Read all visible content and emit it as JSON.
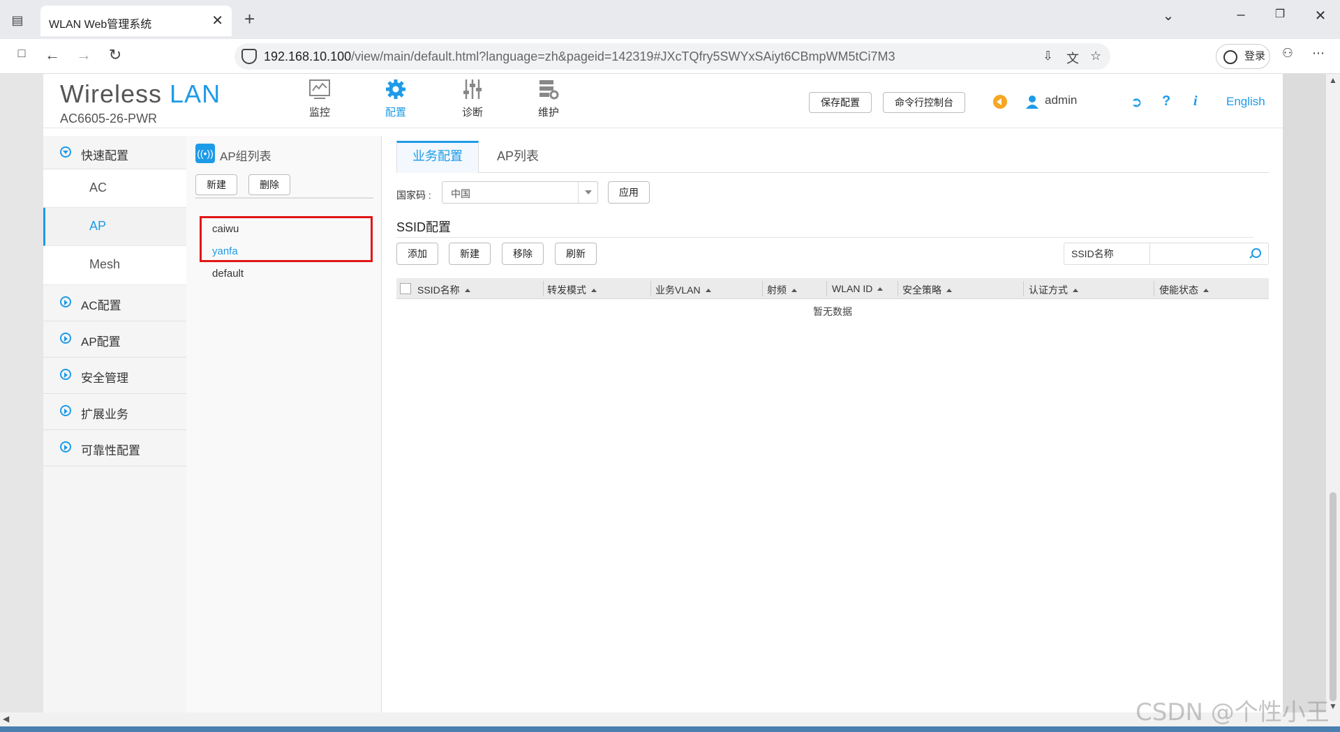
{
  "browser": {
    "tab_title": "WLAN Web管理系统",
    "url_host": "192.168.10.100",
    "url_path": "/view/main/default.html?language=zh&pageid=142319#JXcTQfry5SWYxSAiyt6CBmpWM5tCi7M3",
    "login_label": "登录"
  },
  "header": {
    "brand_wireless": "Wireless",
    "brand_lan": "LAN",
    "model": "AC6605-26-PWR",
    "nav": [
      {
        "label": "监控",
        "icon": "monitor-icon"
      },
      {
        "label": "配置",
        "icon": "gear-icon"
      },
      {
        "label": "诊断",
        "icon": "diagnose-icon"
      },
      {
        "label": "维护",
        "icon": "maintain-icon"
      }
    ],
    "save_label": "保存配置",
    "console_label": "命令行控制台",
    "user": "admin",
    "lang_label": "English"
  },
  "leftnav": {
    "quick": "快速配置",
    "sub": [
      "AC",
      "AP",
      "Mesh"
    ],
    "items": [
      "AC配置",
      "AP配置",
      "安全管理",
      "扩展业务",
      "可靠性配置"
    ]
  },
  "group_panel": {
    "title": "AP组列表",
    "new_label": "新建",
    "delete_label": "删除",
    "groups": [
      "caiwu",
      "yanfa",
      "default"
    ]
  },
  "content": {
    "tabs": [
      "业务配置",
      "AP列表"
    ],
    "country_label": "国家码 :",
    "country_value": "中国",
    "apply_label": "应用",
    "ssid_section": "SSID配置",
    "buttons": [
      "添加",
      "新建",
      "移除",
      "刷新"
    ],
    "search_label": "SSID名称",
    "columns": [
      "SSID名称",
      "转发模式",
      "业务VLAN",
      "射频",
      "WLAN ID",
      "安全策略",
      "认证方式",
      "使能状态"
    ],
    "empty_text": "暂无数据"
  },
  "watermark": "CSDN @个性小王"
}
